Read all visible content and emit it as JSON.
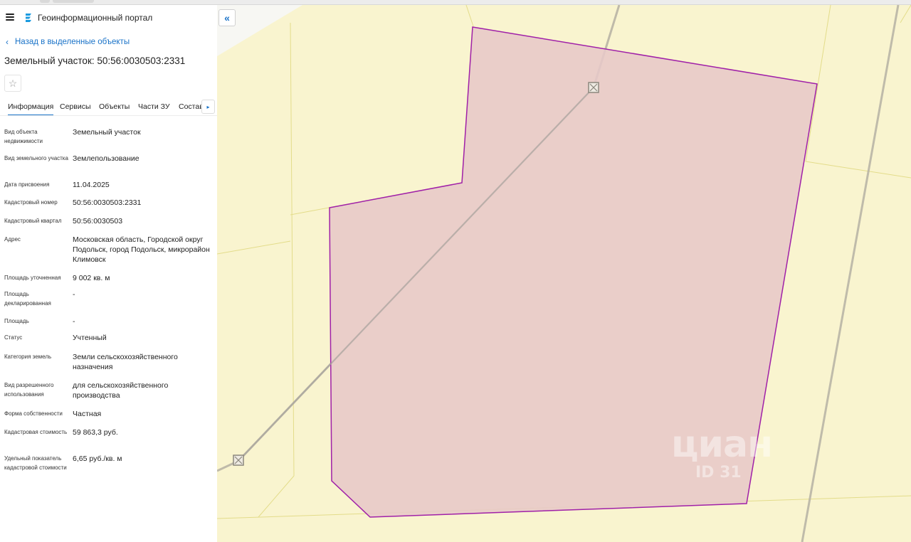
{
  "app": {
    "title": "Геоинформационный портал"
  },
  "nav": {
    "back_label": "Назад в выделенные объекты"
  },
  "object": {
    "title": "Земельный участок: 50:56:0030503:2331",
    "favorite_icon": "☆"
  },
  "tabs": [
    {
      "label": "Информация",
      "active": true
    },
    {
      "label": "Сервисы"
    },
    {
      "label": "Объекты"
    },
    {
      "label": "Части ЗУ"
    },
    {
      "label": "Состав"
    }
  ],
  "tab_more_icon": "▸",
  "details": [
    {
      "label": "Вид объекта недвижимости",
      "value": "Земельный участок"
    },
    {
      "label": "Вид земельного участка",
      "value": "Землепользование"
    },
    {
      "label": "Дата присвоения",
      "value": "11.04.2025"
    },
    {
      "label": "Кадастровый номер",
      "value": "50:56:0030503:2331"
    },
    {
      "label": "Кадастровый квартал",
      "value": "50:56:0030503"
    },
    {
      "label": "Адрес",
      "value": "Московская область, Городской округ Подольск, город Подольск, микрорайон Климовск"
    },
    {
      "label": "Площадь уточненная",
      "value": "9 002 кв. м"
    },
    {
      "label": "Площадь декларированная",
      "value": "-"
    },
    {
      "label": "Площадь",
      "value": "-"
    },
    {
      "label": "Статус",
      "value": "Учтенный"
    },
    {
      "label": "Категория земель",
      "value": "Земли сельскохозяйственного назначения"
    },
    {
      "label": "Вид разрешенного использования",
      "value": "для сельскохозяйственного производства"
    },
    {
      "label": "Форма собственности",
      "value": "Частная"
    },
    {
      "label": "Кадастровая стоимость",
      "value": "59 863,3 руб."
    },
    {
      "label": "Удельный показатель кадастровой стоимости",
      "value": "6,65 руб./кв. м"
    }
  ],
  "map": {
    "collapse_icon": "«",
    "watermark": {
      "brand": "циан",
      "id_text": "ID 31"
    },
    "colors": {
      "background": "#f9f4cf",
      "parcel_fill": "#e7c8c8",
      "parcel_stroke": "#a020a8",
      "boundary": "#e3dc8a",
      "line": "#a8a49c"
    }
  }
}
